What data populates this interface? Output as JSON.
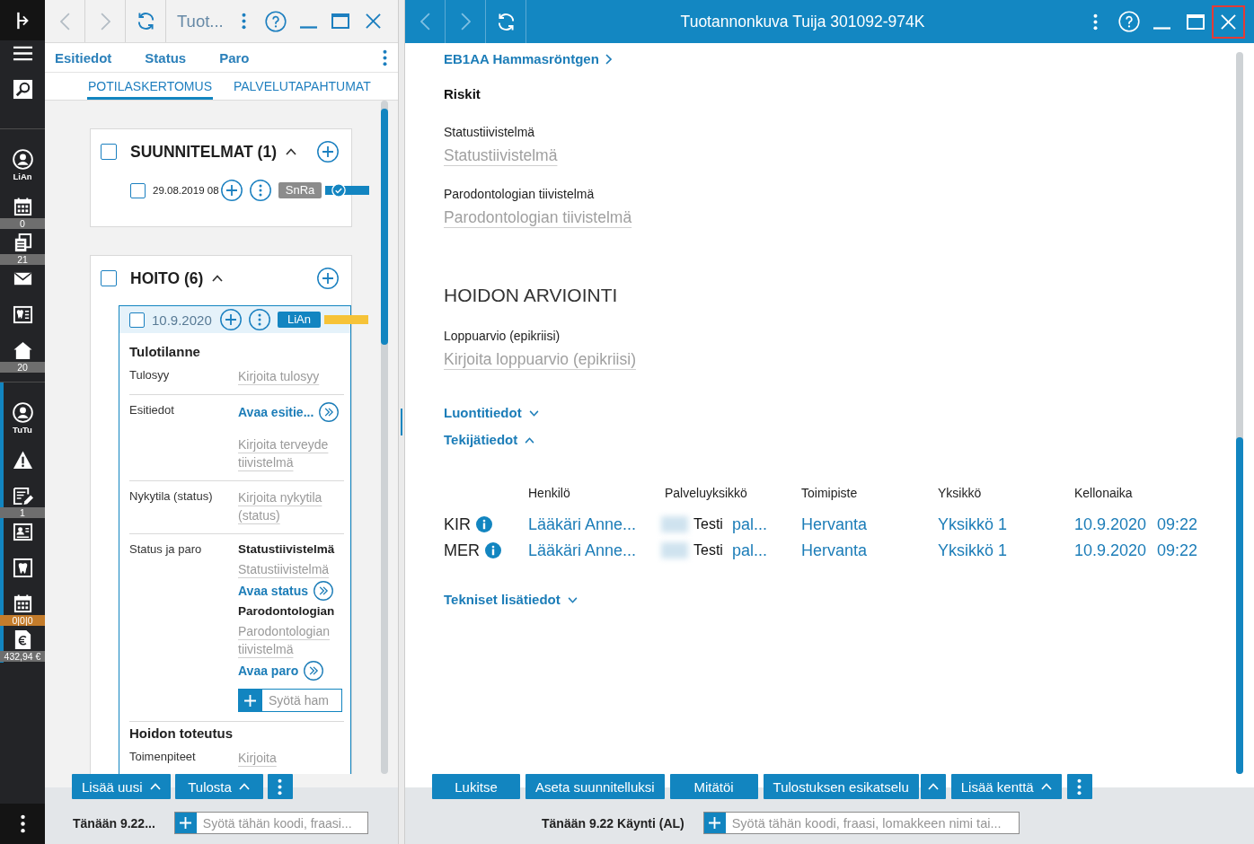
{
  "sidebar": {
    "sections": [
      {
        "label": "LiAn",
        "selected": false,
        "items": [
          {
            "kind": "badged",
            "badge": "0",
            "color": "#6e6e6e"
          },
          {
            "kind": "badged",
            "badge": "21",
            "color": "#6e6e6e"
          },
          {
            "kind": "plain"
          },
          {
            "kind": "plain"
          },
          {
            "kind": "badged",
            "badge": "20",
            "color": "#6e6e6e"
          }
        ]
      },
      {
        "label": "TuTu",
        "selected": true,
        "items": [
          {
            "kind": "plain"
          },
          {
            "kind": "badged",
            "badge": "1",
            "color": "#6e6e6e"
          },
          {
            "kind": "plain"
          },
          {
            "kind": "plain"
          },
          {
            "kind": "badged",
            "badge": "0|0|0",
            "color": "#c47c2b"
          },
          {
            "kind": "badged",
            "badge": "432,94 €",
            "color": "#6e6e6e"
          }
        ]
      }
    ]
  },
  "left_window": {
    "title": "Tuot...",
    "back_disabled": true,
    "forward_disabled": true,
    "links": [
      "Esitiedot",
      "Status",
      "Paro"
    ],
    "tabs": [
      {
        "label": "POTILASKERTOMUS",
        "selected": true
      },
      {
        "label": "PALVELUTAPAHTUMAT",
        "selected": false
      }
    ],
    "groups": [
      {
        "title": "SUUNNITELMAT (1)",
        "checked": false,
        "expanded": true,
        "entries": [
          {
            "date": "29.08.2019 08",
            "checked": false,
            "selected": false,
            "badge": {
              "text": "SnRa",
              "color": "#8c8c8c"
            },
            "status": {
              "color": "#1385c1",
              "approved": true
            }
          }
        ]
      },
      {
        "title": "HOITO (6)",
        "checked": false,
        "expanded": true,
        "entries": [
          {
            "date": "10.9.2020",
            "checked": false,
            "selected": true,
            "badge": {
              "text": "LiAn",
              "color": "#1385c1"
            },
            "status": {
              "color": "#f6c338",
              "approved": false
            },
            "form": [
              {
                "kind": "heading",
                "text": "Tulotilanne"
              },
              {
                "kind": "row",
                "label": "Tulosyy",
                "parts": [
                  {
                    "kind": "text_field",
                    "placeholder": "Kirjoita tulosyy"
                  }
                ]
              },
              {
                "kind": "row",
                "label": "Esitiedot",
                "parts": [
                  {
                    "kind": "link",
                    "text": "Avaa esitie..."
                  },
                  {
                    "kind": "text_field",
                    "placeholder": "Kirjoita terveyde\ntiivistelmä"
                  }
                ]
              },
              {
                "kind": "row",
                "label": "Nykytila (status)",
                "parts": [
                  {
                    "kind": "text_field",
                    "placeholder": "Kirjoita nykytila\n(status)"
                  }
                ]
              },
              {
                "kind": "row",
                "label": "Status ja paro",
                "parts": [
                  {
                    "kind": "title",
                    "text": "Statustiivistelmä"
                  },
                  {
                    "kind": "text_field",
                    "placeholder": "Statustiivistelmä"
                  },
                  {
                    "kind": "link",
                    "text": "Avaa status"
                  },
                  {
                    "kind": "title",
                    "text": "Parodontologian"
                  },
                  {
                    "kind": "text_field",
                    "placeholder": "Parodontologian\ntiivistelmä"
                  },
                  {
                    "kind": "link",
                    "text": "Avaa paro"
                  },
                  {
                    "kind": "input",
                    "placeholder": "Syötä ham"
                  }
                ]
              },
              {
                "kind": "heading",
                "text": "Hoidon toteutus"
              },
              {
                "kind": "row",
                "label": "Toimenpiteet",
                "parts": [
                  {
                    "kind": "text_field",
                    "placeholder": "Kirjoita"
                  }
                ]
              }
            ]
          }
        ]
      }
    ],
    "buttons": [
      {
        "label": "Lisää uusi",
        "kind": "menu"
      },
      {
        "label": "Tulosta",
        "kind": "menu"
      }
    ],
    "status_bar": {
      "text": "Tänään 9.22...",
      "input": {
        "placeholder": "Syötä tähän koodi, fraasi..."
      }
    }
  },
  "right_window": {
    "title": "Tuotannonkuva Tuija 301092-974K",
    "back_disabled": true,
    "forward_disabled": true,
    "close_highlighted": true,
    "link": "EB1AA Hammasröntgen",
    "section_title": "Riskit",
    "fields": [
      {
        "label": "Statustiivistelmä",
        "placeholder": "Statustiivistelmä"
      },
      {
        "label": "Parodontologian tiivistelmä",
        "placeholder": "Parodontologian tiivistelmä"
      }
    ],
    "heading": "HOIDON ARVIOINTI",
    "assessment": {
      "label": "Loppuarvio (epikriisi)",
      "placeholder": "Kirjoita loppuarvio (epikriisi)"
    },
    "toggles": [
      {
        "label": "Luontitiedot",
        "expanded": false
      },
      {
        "label": "Tekijätiedot",
        "expanded": true
      }
    ],
    "table": {
      "columns": [
        "Henkilö",
        "Palveluyksikkö",
        "Toimipiste",
        "Yksikkö",
        "Kellonaika"
      ],
      "rows": [
        {
          "column_1": "KIR",
          "person": "Lääkäri Anne...",
          "service_unit_label": "Testi",
          "service_unit": "pal...",
          "site": "Hervanta",
          "unit": "Yksikkö 1",
          "date": "10.9.2020",
          "time": "09:22"
        },
        {
          "column_1": "MER",
          "person": "Lääkäri Anne...",
          "service_unit_label": "Testi",
          "service_unit": "pal...",
          "site": "Hervanta",
          "unit": "Yksikkö 1",
          "date": "10.9.2020",
          "time": "09:22"
        }
      ]
    },
    "more_toggle": {
      "label": "Tekniset lisätiedot",
      "expanded": false
    },
    "buttons": [
      {
        "label": "Lukitse",
        "kind": "plain"
      },
      {
        "label": "Aseta suunnitelluksi",
        "kind": "plain"
      },
      {
        "label": "Mitätöi",
        "kind": "plain"
      },
      {
        "label": "Tulostuksen esikatselu",
        "kind": "split"
      },
      {
        "label": "Lisää kenttä",
        "kind": "menu"
      }
    ],
    "status_bar": {
      "text": "Tänään 9.22 Käynti (AL)",
      "input": {
        "placeholder": "Syötä tähän koodi, fraasi, lomakkeen nimi tai..."
      }
    }
  }
}
